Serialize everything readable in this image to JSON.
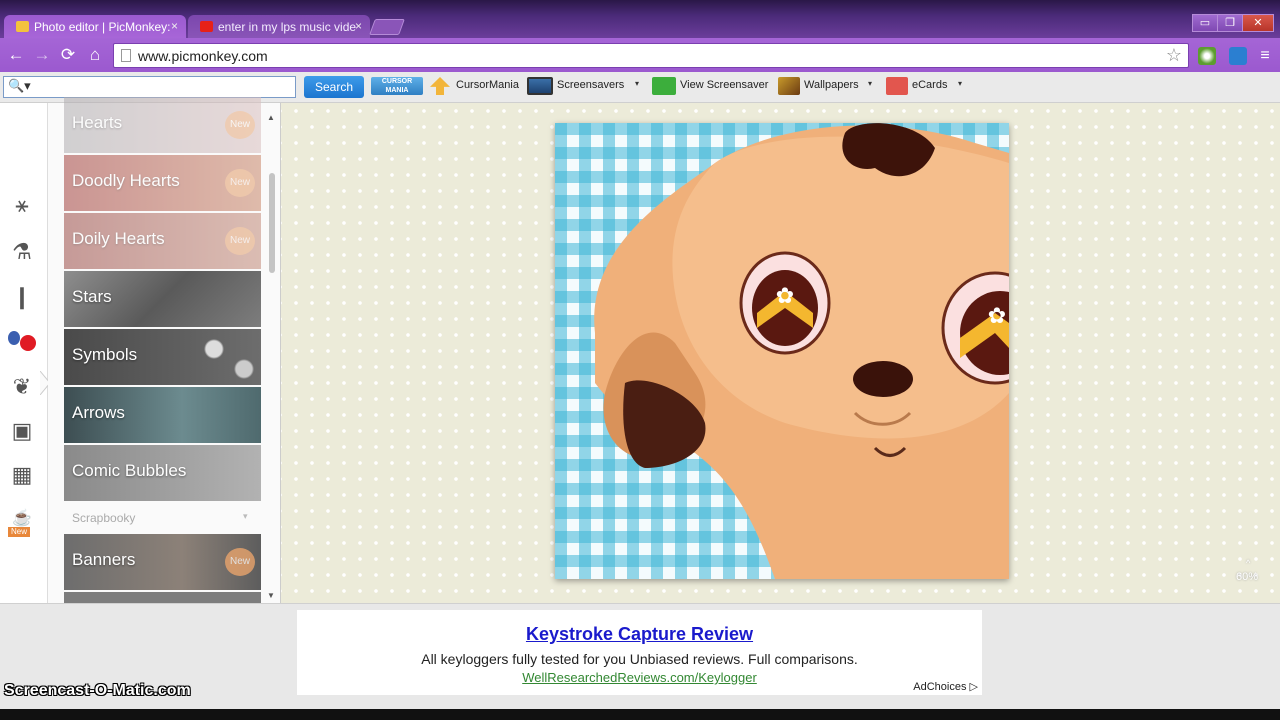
{
  "browser": {
    "tabs": [
      {
        "title": "Photo editor | PicMonkey:",
        "active": true,
        "icon": "picmonkey-favicon",
        "close": "×"
      },
      {
        "title": "enter in my lps music vide",
        "active": false,
        "icon": "youtube-favicon",
        "close": "×"
      }
    ],
    "window_buttons": {
      "minimize": "▭",
      "restore": "❐",
      "close": "✕"
    },
    "nav": {
      "back": "←",
      "forward": "→",
      "reload": "⟳",
      "home": "⌂"
    },
    "url": "www.picmonkey.com",
    "bookmark_star": "☆"
  },
  "search_toolbar": {
    "search_placeholder": "",
    "search_icon": "🔍▾",
    "search_button": "Search",
    "items": [
      {
        "label": "CursorMania",
        "icon": "cursormania-logo"
      },
      {
        "label": "Screensavers",
        "icon": "monitor-icon"
      },
      {
        "label": "View Screensaver",
        "icon": "green-arrow-icon"
      },
      {
        "label": "Wallpapers",
        "icon": "wallpaper-icon"
      },
      {
        "label": "eCards",
        "icon": "ecard-icon"
      }
    ],
    "dropdown_glyph": "▾"
  },
  "editor": {
    "rail_icons": [
      "effects-icon",
      "flask-icon",
      "brush-icon",
      "lollipop-icon",
      "butterfly-icon",
      "frame-icon",
      "texture-icon",
      "themes-icon"
    ],
    "rail_new_badge": "New",
    "overlays": [
      {
        "label": "Hearts",
        "new": true
      },
      {
        "label": "Doodly Hearts",
        "new": true
      },
      {
        "label": "Doily Hearts",
        "new": true
      },
      {
        "label": "Stars",
        "new": false
      },
      {
        "label": "Symbols",
        "new": false
      },
      {
        "label": "Arrows",
        "new": false
      },
      {
        "label": "Comic Bubbles",
        "new": false
      }
    ],
    "section_header": "Scrapbooky",
    "section_chevron": "▾",
    "section_items": [
      {
        "label": "Banners",
        "new": true
      }
    ],
    "new_badge_text": "New",
    "zoom_label": "60%",
    "zoom_up": "^"
  },
  "ad": {
    "title": "Keystroke Capture Review",
    "text": "All keyloggers fully tested for you Unbiased reviews. Full comparisons.",
    "link": "WellResearchedReviews.com/Keylogger",
    "adchoices": "AdChoices ▷"
  },
  "watermark": "Screencast-O-Matic.com",
  "colors": {
    "chrome_purple": "#9b59cf",
    "search_blue": "#1c75cf",
    "ad_link_blue": "#1a1acc",
    "ad_url_green": "#338833"
  }
}
